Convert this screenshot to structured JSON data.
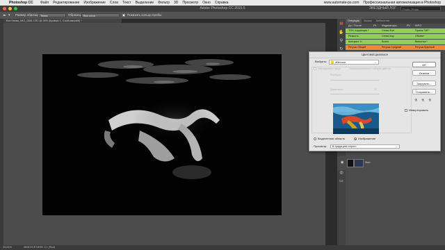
{
  "mac_menubar": {
    "apple_icon": "apple-icon",
    "app_name": "Photoshop CC",
    "menus": [
      "Файл",
      "Редактирование",
      "Изображение",
      "Слои",
      "Текст",
      "Выделение",
      "Фильтр",
      "3D",
      "Просмотр",
      "Окно",
      "Справка"
    ],
    "right_items": [
      "www.automate-ps.com",
      "Профессиональная автоматизация в Photoshop"
    ]
  },
  "window": {
    "title": "Adobe Photoshop CC 2015.5",
    "workspace": "ЗВЁЗДНЫЙ ЛОГ",
    "workspace_box": "Photo_Photo"
  },
  "options_bar": {
    "sample_size_label": "Размер образца:",
    "sample_size_value": "Точка",
    "sample_label": "Образец:",
    "sample_value": "Все слои",
    "show_ring_label": "Показать кольцо пробы"
  },
  "document": {
    "tab_label": "Без Назва_IMG_0861.CR2 @ 26% (Кривые 1, Слой-маска/8) *"
  },
  "status_bar": {
    "zoom": "26,61%",
    "doc_info": "4608 ЕСЕТИН9: 2,1 (Фон)"
  },
  "panel": {
    "tabs": [
      "Операции",
      "Заказы",
      "Библиотеки"
    ],
    "header": [
      "До / После",
      "F4",
      "Индикаторы",
      "F5",
      "INFO"
    ],
    "rows": [
      {
        "c1": "ТОН. Коррекция *",
        "c2": "Сепия Фон",
        "c3": "Прием TMF*",
        "color": "#8fcf5a"
      },
      {
        "c1": "Резкость",
        "c2": "Сепия Кар",
        "c3": "Объём+",
        "color": "#8fcf5a"
      },
      {
        "c1": "Контраст +/-",
        "c2": "Бохно",
        "c3": "Виньетка *",
        "color": "#8fcf5a"
      },
      {
        "c1": "Ретушь Общий",
        "c2": "Ретушь Средний",
        "c3": "Ретушь Крупный",
        "color": "#e98b3d"
      }
    ]
  },
  "dialog": {
    "title": "Цветовой диапазон",
    "select_label": "Выбрать:",
    "select_value": "Жёлтые",
    "localized_label": "Определить лица",
    "localized_sets_label": "Локализованные наборы цветов",
    "fuzziness_label": "Разброс:",
    "range_label": "Диапазон:",
    "range_unit": "%",
    "selection_label": "Выделенная область",
    "image_label": "Изображение",
    "preview_label": "Просмотр:",
    "preview_value": "В градациях серого",
    "invert_label": "Инвертировать",
    "buttons": {
      "ok": "OK",
      "cancel": "Отмена",
      "load": "Загрузить...",
      "save": "Сохранить..."
    },
    "accent_swatch": "#f5d31b"
  },
  "layers": {
    "background_label": "Фон"
  }
}
